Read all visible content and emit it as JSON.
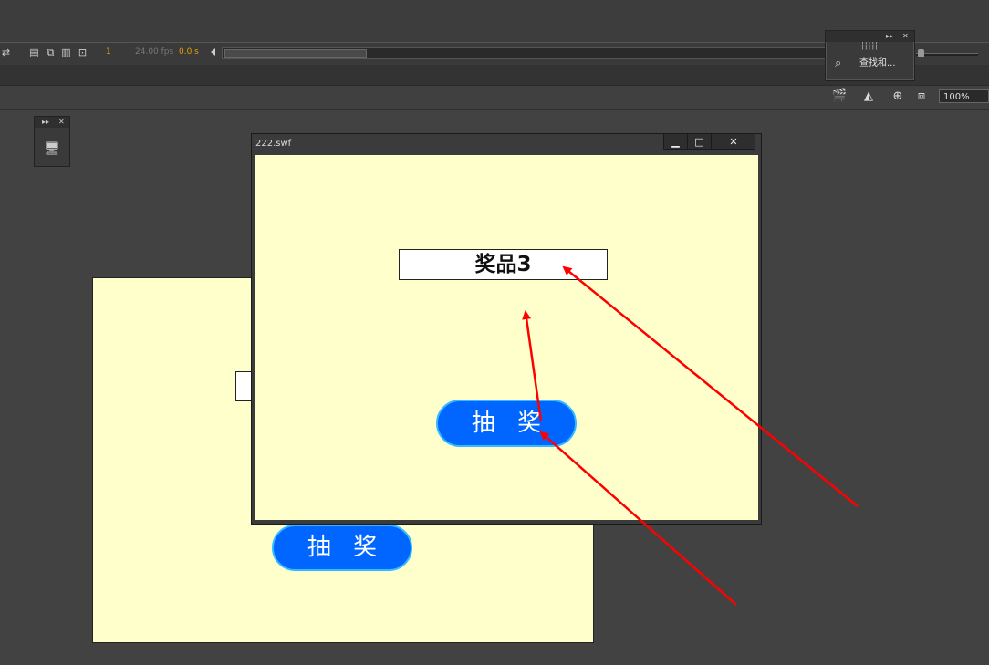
{
  "toolbar": {
    "frame_number": "1",
    "fps": "24.00 fps",
    "time": "0.0 s"
  },
  "find_panel": {
    "label": "查找和..."
  },
  "edit_bar": {
    "zoom": "100%"
  },
  "stage": {
    "draw_button_label": "抽 奖"
  },
  "swf_window": {
    "title": "222.swf",
    "prize_text": "奖品3",
    "draw_button_label": "抽 奖",
    "minimize_glyph": "▁",
    "maximize_glyph": "□",
    "close_glyph": "✕"
  },
  "colors": {
    "stage_bg": "#ffffcc",
    "button_fill": "#0066ff",
    "button_border": "#33bbff",
    "annotation_arrow": "#ff0000",
    "frame_indicator": "#e8a000"
  },
  "icons": [
    "edit-scene-icon",
    "onion-skin-icon",
    "find-replace-icon",
    "clapper-icon",
    "snap-icon",
    "center-stage-icon",
    "clip-icon",
    "monitor-icon"
  ]
}
